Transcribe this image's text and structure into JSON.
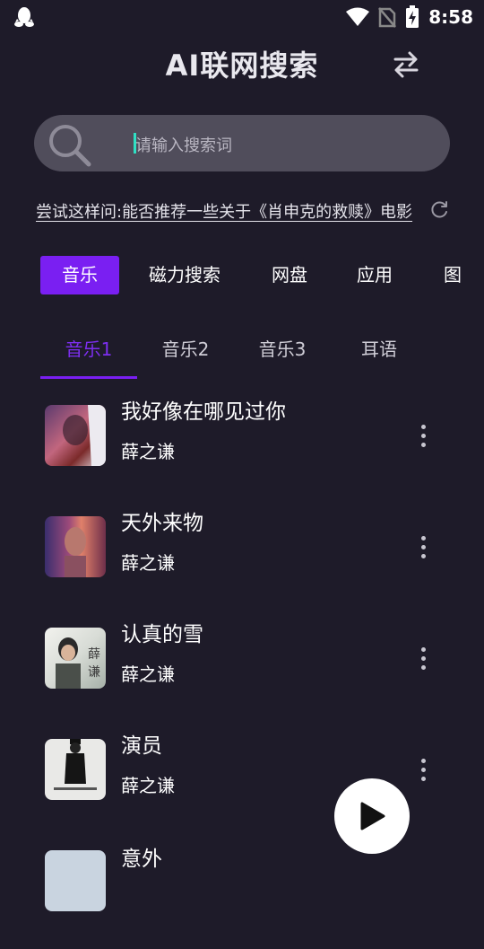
{
  "status_bar": {
    "time": "8:58",
    "icons": [
      "qq-icon",
      "wifi-icon",
      "no-sim-icon",
      "battery-charging-icon"
    ]
  },
  "header": {
    "title": "AI联网搜索",
    "switch_icon": "swap-arrows-icon"
  },
  "search": {
    "placeholder": "请输入搜索词",
    "icon": "search-icon"
  },
  "suggestion": {
    "text": "尝试这样问:能否推荐一些关于《肖申克的救赎》电影",
    "icon": "refresh-icon"
  },
  "category_tabs": [
    {
      "label": "音乐",
      "active": true
    },
    {
      "label": "磁力搜索",
      "active": false
    },
    {
      "label": "网盘",
      "active": false
    },
    {
      "label": "应用",
      "active": false
    },
    {
      "label": "图",
      "active": false
    }
  ],
  "sub_tabs": [
    {
      "label": "音乐1",
      "active": true
    },
    {
      "label": "音乐2",
      "active": false
    },
    {
      "label": "音乐3",
      "active": false
    },
    {
      "label": "耳语",
      "active": false
    }
  ],
  "songs": [
    {
      "title": "我好像在哪见过你",
      "artist": "薛之谦"
    },
    {
      "title": "天外来物",
      "artist": "薛之谦"
    },
    {
      "title": "认真的雪",
      "artist": "薛之谦"
    },
    {
      "title": "演员",
      "artist": "薛之谦"
    },
    {
      "title": "意外",
      "artist": ""
    }
  ],
  "colors": {
    "background": "#1e1b29",
    "accent": "#7a1ff2",
    "search_bg": "#504d5b",
    "cursor": "#2fe0c4"
  },
  "player": {
    "icon": "play-icon"
  }
}
